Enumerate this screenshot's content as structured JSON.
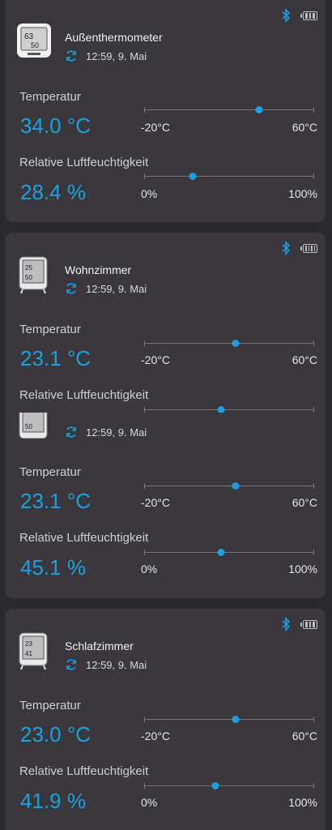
{
  "colors": {
    "accent": "#1aa0e0",
    "card": "#3a383d",
    "background": "#2b2a2d"
  },
  "labels": {
    "temperature": "Temperatur",
    "humidity": "Relative Luftfeuchtigkeit",
    "temp_min": "-20°C",
    "temp_max": "60°C",
    "hum_min": "0%",
    "hum_max": "100%"
  },
  "devices": [
    {
      "name": "Außenthermometer",
      "sync_time": "12:59,  9. Mai",
      "temperature": "34.0 °C",
      "temp_fraction": 0.675,
      "humidity": "28.4 %",
      "hum_fraction": 0.284
    },
    {
      "name": "Wohnzimmer",
      "sync_time": "12:59,  9. Mai",
      "temperature": "23.1 °C",
      "temp_fraction": 0.539,
      "humidity": "45.1 %",
      "hum_fraction": 0.451
    },
    {
      "name": "",
      "sync_time": "12:59,  9. Mai",
      "temperature": "23.1 °C",
      "temp_fraction": 0.539,
      "humidity": "45.1 %",
      "hum_fraction": 0.451
    },
    {
      "name": "Schlafzimmer",
      "sync_time": "12:59,  9. Mai",
      "temperature": "23.0 °C",
      "temp_fraction": 0.538,
      "humidity": "41.9 %",
      "hum_fraction": 0.419
    }
  ],
  "icons": {
    "bluetooth": "bluetooth-icon",
    "battery": "battery-icon",
    "sync": "sync-icon",
    "device": "thermometer-device-icon"
  }
}
